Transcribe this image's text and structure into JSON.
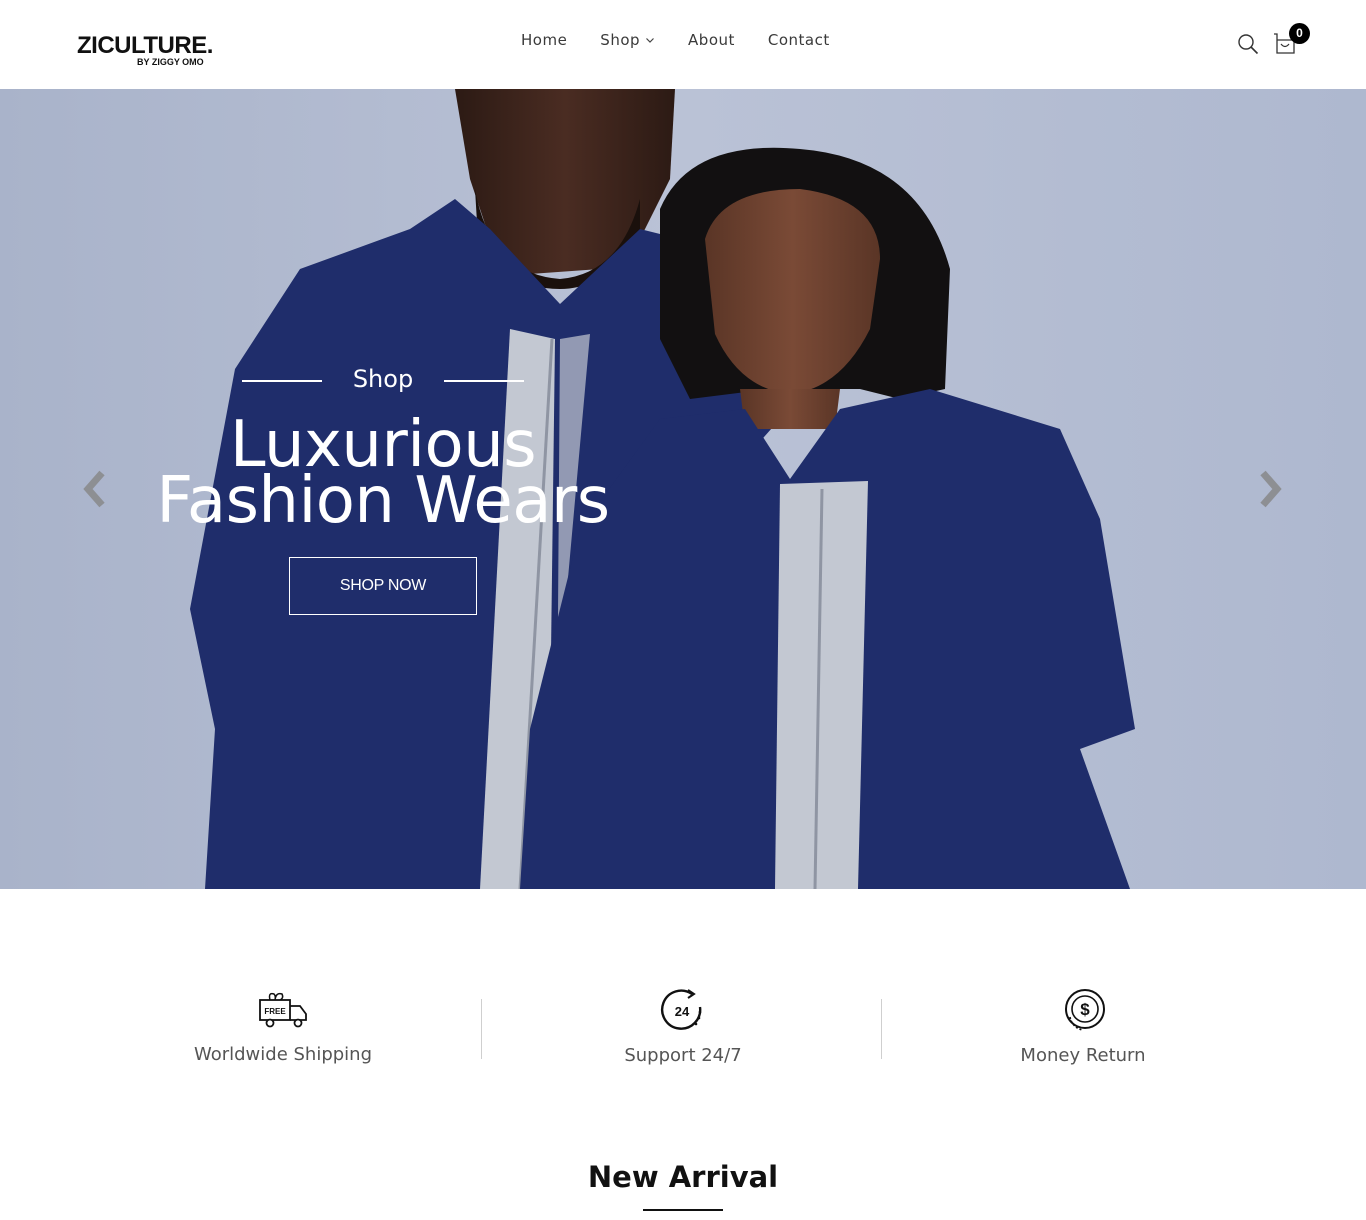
{
  "header": {
    "logo": {
      "name": "ZICULTURE.",
      "tagline": "BY ZIGGY OMO"
    },
    "nav": [
      {
        "label": "Home"
      },
      {
        "label": "Shop",
        "has_dropdown": true
      },
      {
        "label": "About"
      },
      {
        "label": "Contact"
      }
    ],
    "cart_count": "0",
    "icons": {
      "search": "search-icon",
      "cart": "cart-icon"
    }
  },
  "hero": {
    "kicker": "Shop",
    "title_line1": "Luxurious",
    "title_line2": "Fashion Wears",
    "button": "SHOP NOW",
    "prev_icon": "chevron-left-icon",
    "next_icon": "chevron-right-icon"
  },
  "features": [
    {
      "icon": "free-delivery-truck-icon",
      "label": "Worldwide Shipping"
    },
    {
      "icon": "support-24-clock-icon",
      "label": "Support 24/7"
    },
    {
      "icon": "money-return-icon",
      "label": "Money Return"
    }
  ],
  "section": {
    "title": "New Arrival"
  },
  "colors": {
    "accent": "#000000",
    "hero_bg": "#b6bfd4",
    "shirt_navy": "#1f2d6b"
  }
}
